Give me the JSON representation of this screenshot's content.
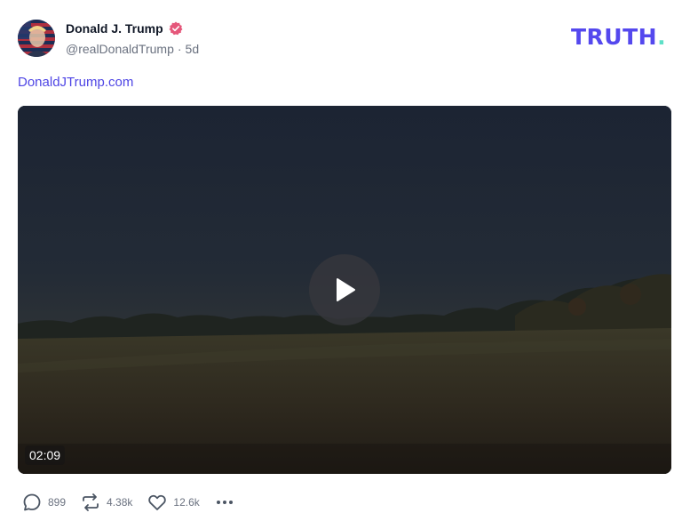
{
  "author": {
    "display_name": "Donald J. Trump",
    "handle": "@realDonaldTrump",
    "separator": "·",
    "time_ago": "5d",
    "verified": true
  },
  "brand": {
    "logo_text": "TRUTH",
    "logo_dot": "."
  },
  "post": {
    "link_text": "DonaldJTrump.com"
  },
  "video": {
    "duration": "02:09",
    "state": "paused"
  },
  "actions": {
    "replies": "899",
    "retruths": "4.38k",
    "likes": "12.6k"
  },
  "colors": {
    "accent": "#5448ee",
    "brand_dot": "#5ee0c7",
    "verified_badge": "#e5577a",
    "link": "#4f46e5",
    "muted_text": "#6b7280"
  },
  "icons": {
    "verified": "verified-badge-icon",
    "play": "play-icon",
    "reply": "reply-icon",
    "retruth": "retruth-icon",
    "like": "heart-icon",
    "more": "more-icon"
  }
}
